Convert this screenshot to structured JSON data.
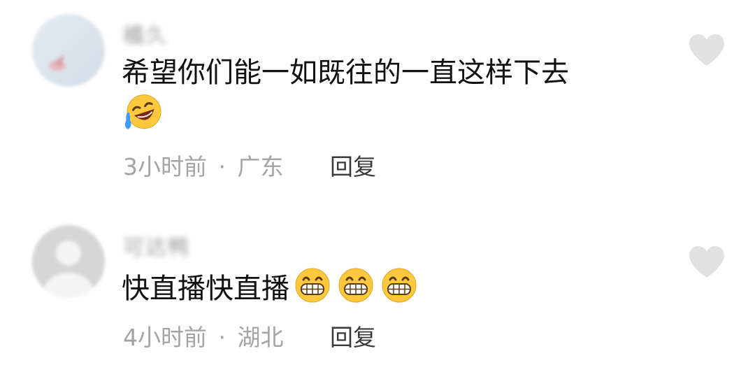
{
  "comments": [
    {
      "username": "橘久",
      "text": "希望你们能一如既往的一直这样下去",
      "emojis": [
        "laughing-tears-emoji"
      ],
      "time": "3小时前",
      "separator": "·",
      "location": "广东",
      "reply_label": "回复",
      "like_icon": "heart-icon"
    },
    {
      "username": "可达鸭",
      "text": "快直播快直播",
      "emojis": [
        "grin-emoji",
        "grin-emoji",
        "grin-emoji"
      ],
      "time": "4小时前",
      "separator": "·",
      "location": "湖北",
      "reply_label": "回复",
      "like_icon": "heart-icon"
    }
  ],
  "colors": {
    "text": "#111111",
    "meta": "#a4a4a4",
    "reply": "#3a3a3a",
    "heart": "#e2e2e2",
    "emoji_yellow": "#ffc83d"
  }
}
